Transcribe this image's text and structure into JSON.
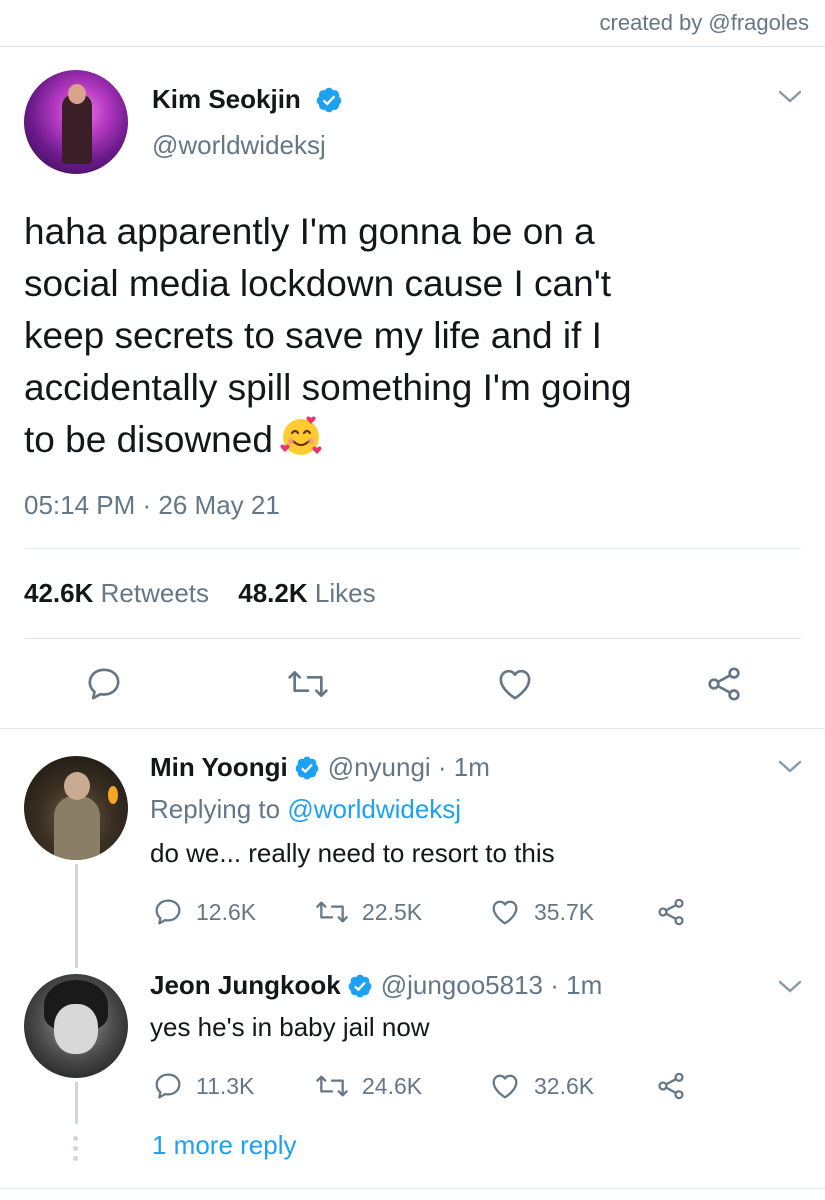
{
  "credit": "created by @fragoles",
  "tweet": {
    "name": "Kim Seokjin",
    "handle": "@worldwideksj",
    "text_lines": [
      "haha apparently I'm gonna be on a",
      "social media lockdown cause I can't",
      "keep secrets to save my life and if I",
      "accidentally spill something I'm going",
      "to be disowned"
    ],
    "emoji": "smiling-face-with-hearts",
    "timestamp": "05:14 PM · 26 May 21",
    "retweets_count": "42.6K",
    "retweets_label": "Retweets",
    "likes_count": "48.2K",
    "likes_label": "Likes"
  },
  "replies": [
    {
      "name": "Min Yoongi",
      "handle": "@nyungi · 1m",
      "replying_prefix": "Replying to",
      "replying_to": "@worldwideksj",
      "text": "do we... really need to resort to this",
      "replies": "12.6K",
      "retweets": "22.5K",
      "likes": "35.7K"
    },
    {
      "name": "Jeon Jungkook",
      "handle": "@jungoo5813 · 1m",
      "text": "yes he's in baby jail now",
      "replies": "11.3K",
      "retweets": "24.6K",
      "likes": "32.6K"
    }
  ],
  "more_replies": "1 more reply",
  "colors": {
    "accent": "#1da1f2",
    "secondary_text": "#657786",
    "primary_text": "#14171a",
    "divider": "#e1e8ed"
  }
}
